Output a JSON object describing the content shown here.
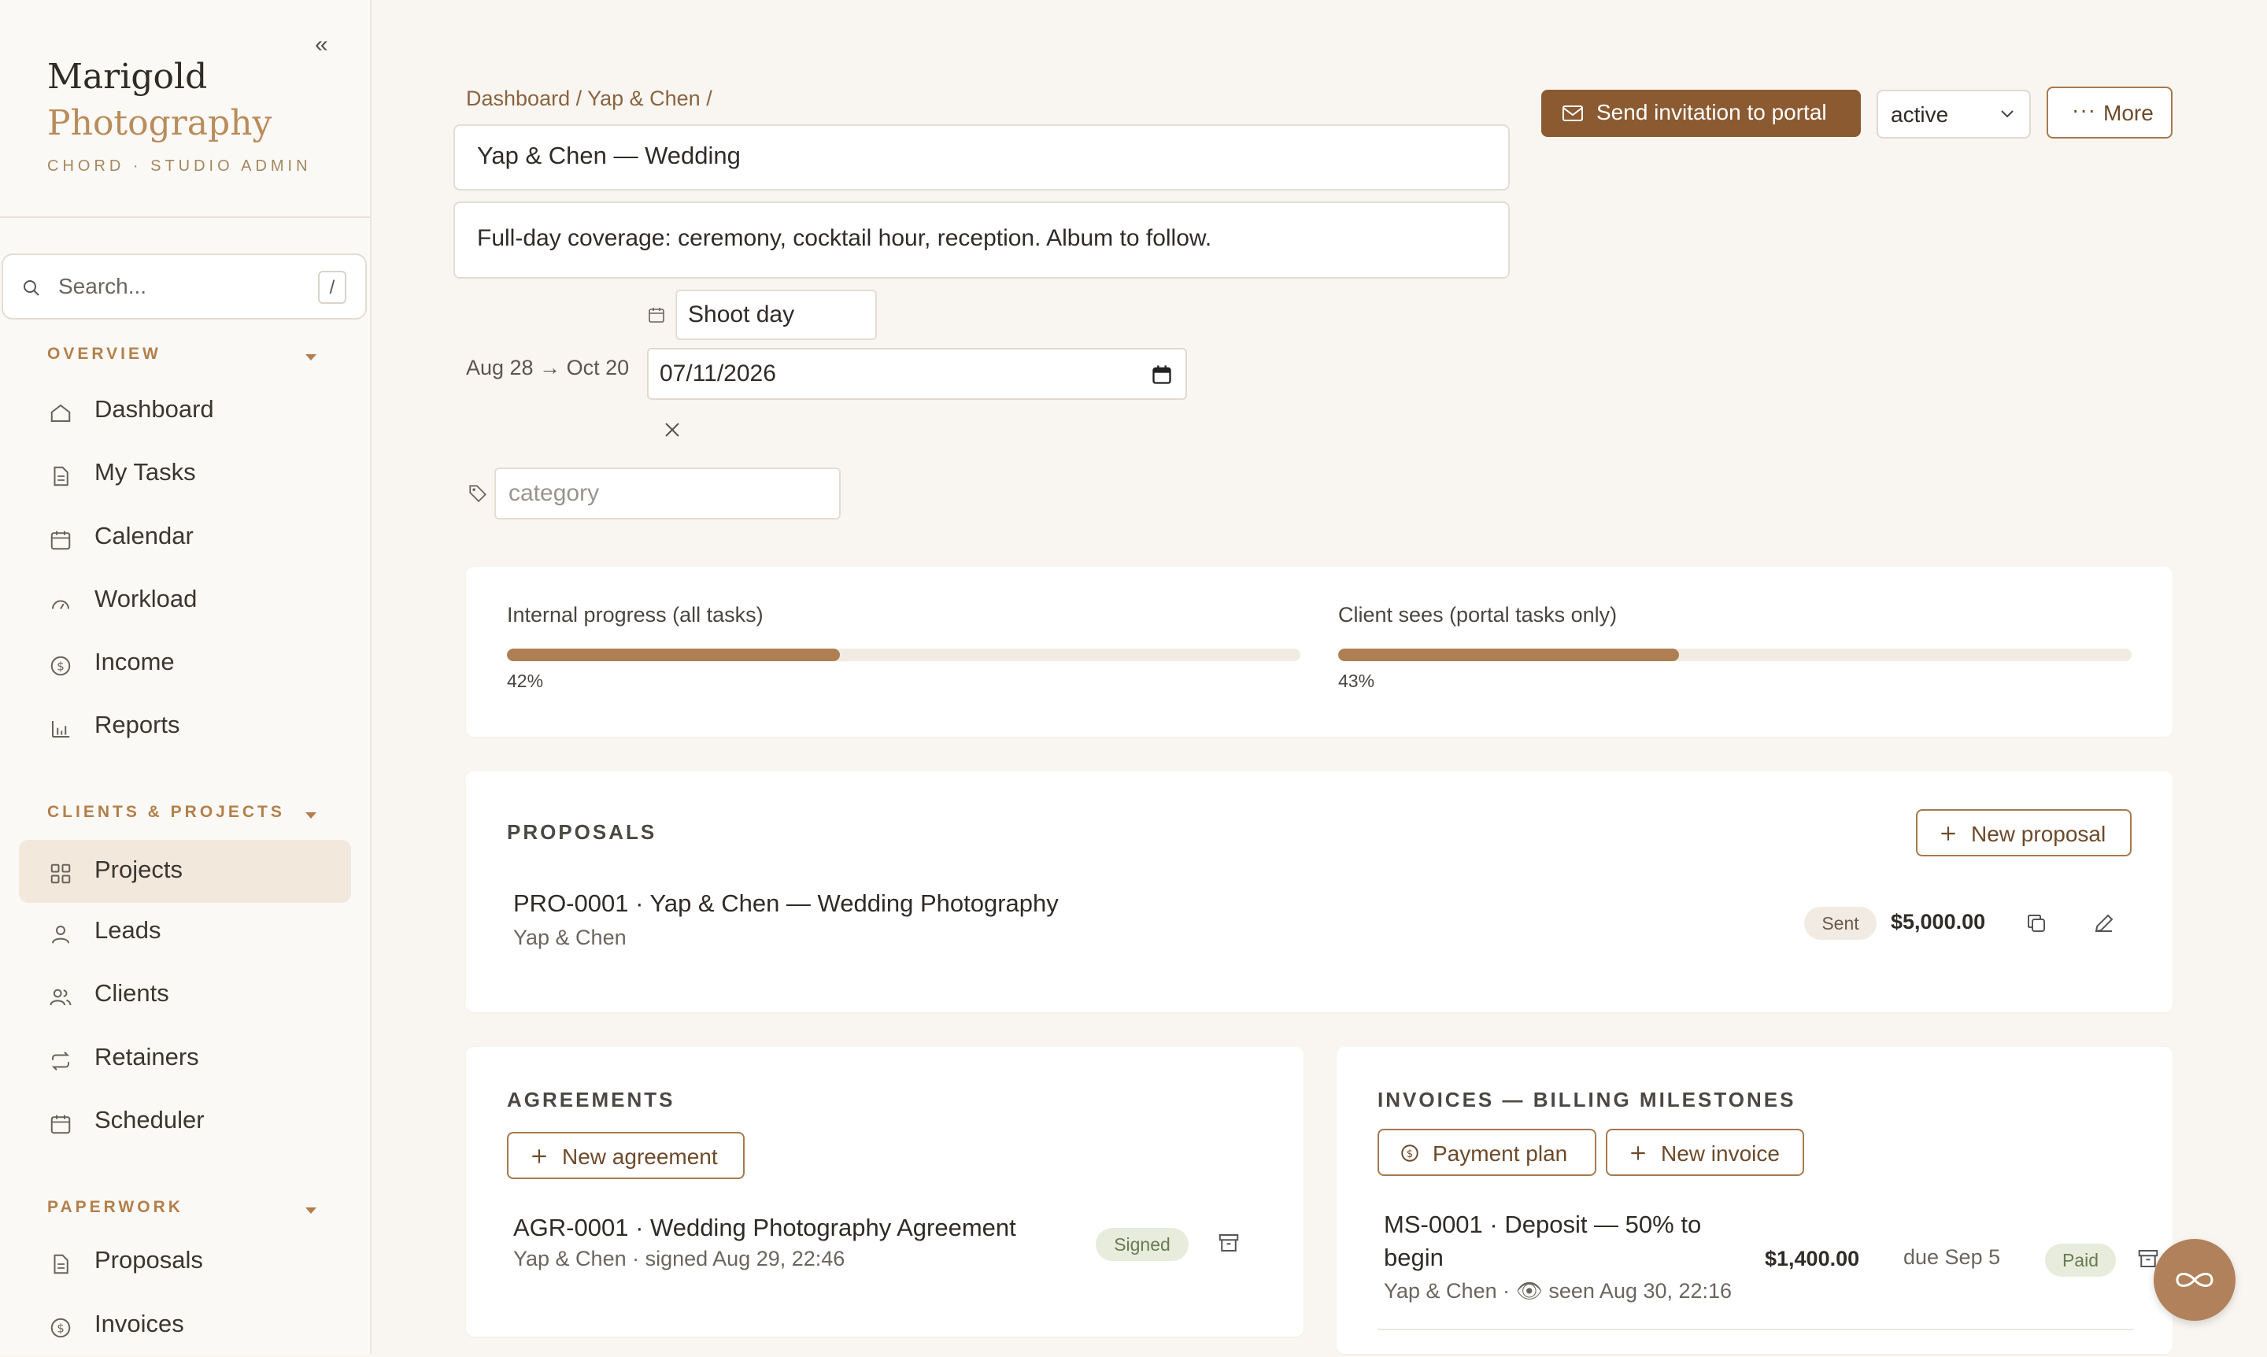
{
  "brand": {
    "line1": "Marigold",
    "line2": "Photography",
    "line3": "CHORD · STUDIO ADMIN"
  },
  "sidebar": {
    "collapse_glyph": "«",
    "search": {
      "placeholder": "Search...",
      "shortcut": "/"
    },
    "sections": [
      {
        "label": "OVERVIEW"
      },
      {
        "label": "CLIENTS & PROJECTS"
      },
      {
        "label": "PAPERWORK"
      }
    ],
    "items": [
      {
        "label": "Dashboard",
        "icon": "home-icon"
      },
      {
        "label": "My Tasks",
        "icon": "document-icon"
      },
      {
        "label": "Calendar",
        "icon": "calendar-icon"
      },
      {
        "label": "Workload",
        "icon": "gauge-icon"
      },
      {
        "label": "Income",
        "icon": "dollar-icon"
      },
      {
        "label": "Reports",
        "icon": "bar-chart-icon"
      },
      {
        "label": "Projects",
        "icon": "grid-icon",
        "active": true
      },
      {
        "label": "Leads",
        "icon": "user-icon"
      },
      {
        "label": "Clients",
        "icon": "users-icon"
      },
      {
        "label": "Retainers",
        "icon": "repeat-icon"
      },
      {
        "label": "Scheduler",
        "icon": "calendar-icon"
      },
      {
        "label": "Proposals",
        "icon": "document-icon"
      },
      {
        "label": "Invoices",
        "icon": "dollar-icon"
      }
    ]
  },
  "header": {
    "breadcrumb": "Dashboard / Yap & Chen /",
    "title": "Yap & Chen — Wedding",
    "description": "Full-day coverage: ceremony, cocktail hour, reception. Album to follow.",
    "send_invitation": "Send invitation to portal",
    "status": "active",
    "more": "More",
    "more_glyph": "···"
  },
  "schedule": {
    "range": "Aug 28 → Oct 20",
    "event_label": "Shoot day",
    "event_date": "07/11/2026",
    "category_placeholder": "category"
  },
  "progress": {
    "internal": {
      "label": "Internal progress (all tasks)",
      "value": 42,
      "text": "42%"
    },
    "client": {
      "label": "Client sees (portal tasks only)",
      "value": 43,
      "text": "43%"
    }
  },
  "proposals": {
    "title": "PROPOSALS",
    "new_button": "New proposal",
    "rows": [
      {
        "title": "PRO-0001 · Yap & Chen — Wedding Photography",
        "sub": "Yap & Chen",
        "status": "Sent",
        "amount": "$5,000.00"
      }
    ]
  },
  "agreements": {
    "title": "AGREEMENTS",
    "new_button": "New agreement",
    "rows": [
      {
        "title": "AGR-0001 · Wedding Photography Agreement",
        "sub": "Yap & Chen · signed Aug 29, 22:46",
        "status": "Signed"
      }
    ]
  },
  "invoices": {
    "title": "INVOICES — BILLING MILESTONES",
    "payment_plan": "Payment plan",
    "new_button": "New invoice",
    "rows": [
      {
        "title_line1": "MS-0001 · Deposit — 50% to",
        "title_line2": "begin",
        "sub": "Yap & Chen · 👁 seen Aug 30, 22:16",
        "amount": "$1,400.00",
        "due": "due Sep 5",
        "status": "Paid"
      }
    ]
  },
  "colors": {
    "accent": "#8b5a31",
    "accent_light": "#ad7f52",
    "background": "#f9f6f1",
    "section_label": "#b37f4a"
  }
}
